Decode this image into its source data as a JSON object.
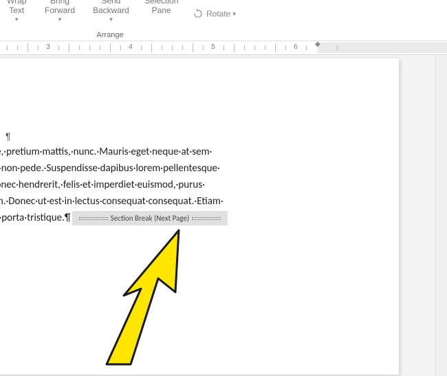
{
  "ribbon": {
    "wrap_text": {
      "line1": "Wrap",
      "line2": "Text"
    },
    "bring_forward": {
      "line1": "Bring",
      "line2": "Forward"
    },
    "send_backward": {
      "line1": "Send",
      "line2": "Backward"
    },
    "selection_pane": {
      "line1": "Selection",
      "line2": "Pane"
    },
    "rotate": "Rotate",
    "group_label": "Arrange"
  },
  "ruler": {
    "labels": [
      "3",
      "4",
      "5",
      "6"
    ]
  },
  "document": {
    "pilcrow": "¶",
    "lines": [
      "vulputate·vitae,·pretium·mattis,·nunc.·Mauris·eget·neque·at·sem·",
      "e·aliquet·pede·non·pede.·Suspendisse·dapibus·lorem·pellentesque·",
      "ugiat·ligula.·Donec·hendrerit,·felis·et·imperdiet·euismod,·purus·",
      "nisl·eget·sapien.·Donec·ut·est·in·lectus·consequat·consequat.·Etiam·",
      "·lorem·in·nunc·porta·tristique.¶"
    ],
    "section_break_label": "Section Break (Next Page)"
  }
}
